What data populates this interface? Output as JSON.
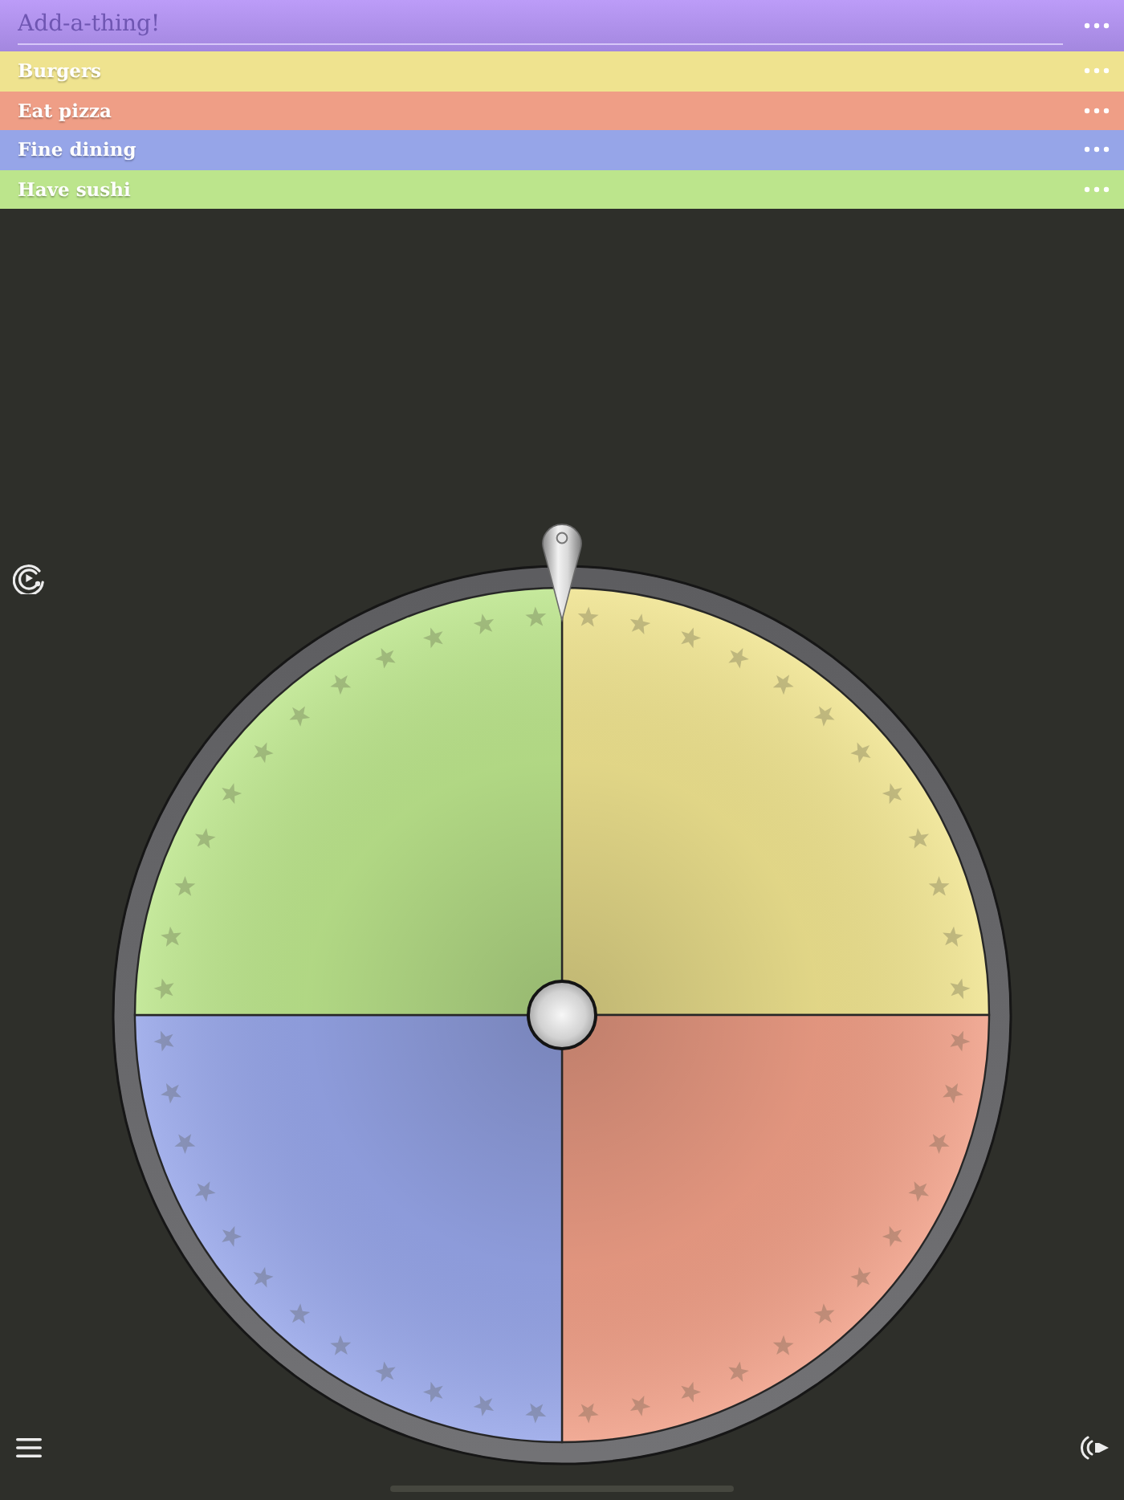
{
  "add_field": {
    "placeholder": "Add-a-thing!"
  },
  "items": [
    {
      "label": "Burgers",
      "color": "#efe38f"
    },
    {
      "label": "Eat pizza",
      "color": "#ef9e86"
    },
    {
      "label": "Fine dining",
      "color": "#96a5e8"
    },
    {
      "label": "Have sushi",
      "color": "#bce58c"
    }
  ]
}
